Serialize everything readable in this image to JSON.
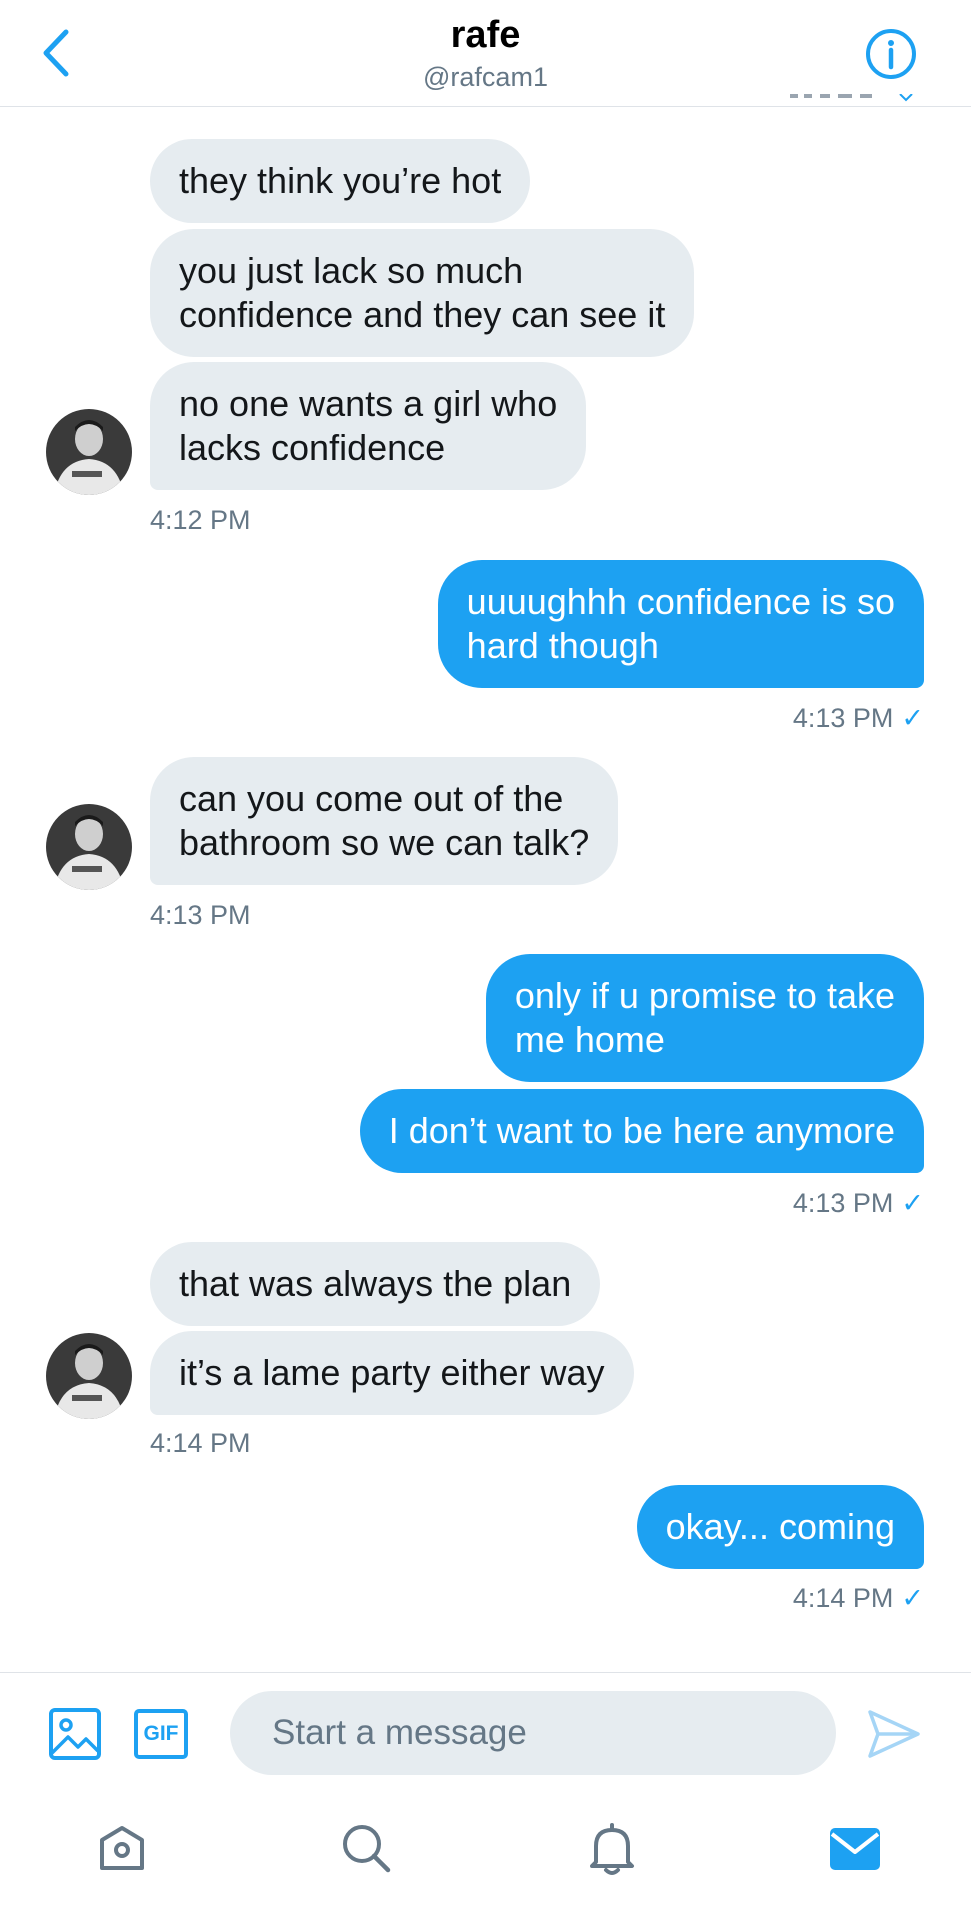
{
  "header": {
    "title": "rafe",
    "handle": "@rafcam1"
  },
  "messages": [
    {
      "side": "in",
      "text": "they think you’re hot"
    },
    {
      "side": "in",
      "text": "you just lack so much\nconfidence and they can see it"
    },
    {
      "side": "in",
      "text": "no one wants a girl who\nlacks confidence"
    },
    {
      "side": "in_ts",
      "time": "4:12 PM"
    },
    {
      "side": "out",
      "text": "uuuughhh confidence is so\nhard though"
    },
    {
      "side": "out_ts",
      "time": "4:13 PM"
    },
    {
      "side": "in",
      "text": "can you come out of the\nbathroom so we can talk?"
    },
    {
      "side": "in_ts",
      "time": "4:13 PM"
    },
    {
      "side": "out",
      "text": "only if u promise to take\nme home"
    },
    {
      "side": "out",
      "text": "I don’t want to be here anymore"
    },
    {
      "side": "out_ts",
      "time": "4:13 PM"
    },
    {
      "side": "in",
      "text": "that was always the plan"
    },
    {
      "side": "in",
      "text": "it’s a lame party either way"
    },
    {
      "side": "in_ts",
      "time": "4:14 PM"
    },
    {
      "side": "out",
      "text": "okay... coming"
    },
    {
      "side": "out_ts",
      "time": "4:14 PM"
    }
  ],
  "read_check": "✓",
  "composer": {
    "placeholder": "Start a message",
    "gif_label": "GIF"
  },
  "colors": {
    "accent": "#1da1f2",
    "incoming_bubble": "#e6ecf0",
    "muted_text": "#657786"
  },
  "icons": {
    "back": "chevron-left-icon",
    "info": "info-icon",
    "image": "image-icon",
    "gif": "gif-icon",
    "send": "send-icon",
    "home": "home-icon",
    "search": "search-icon",
    "notifications": "bell-icon",
    "messages": "mail-icon"
  }
}
